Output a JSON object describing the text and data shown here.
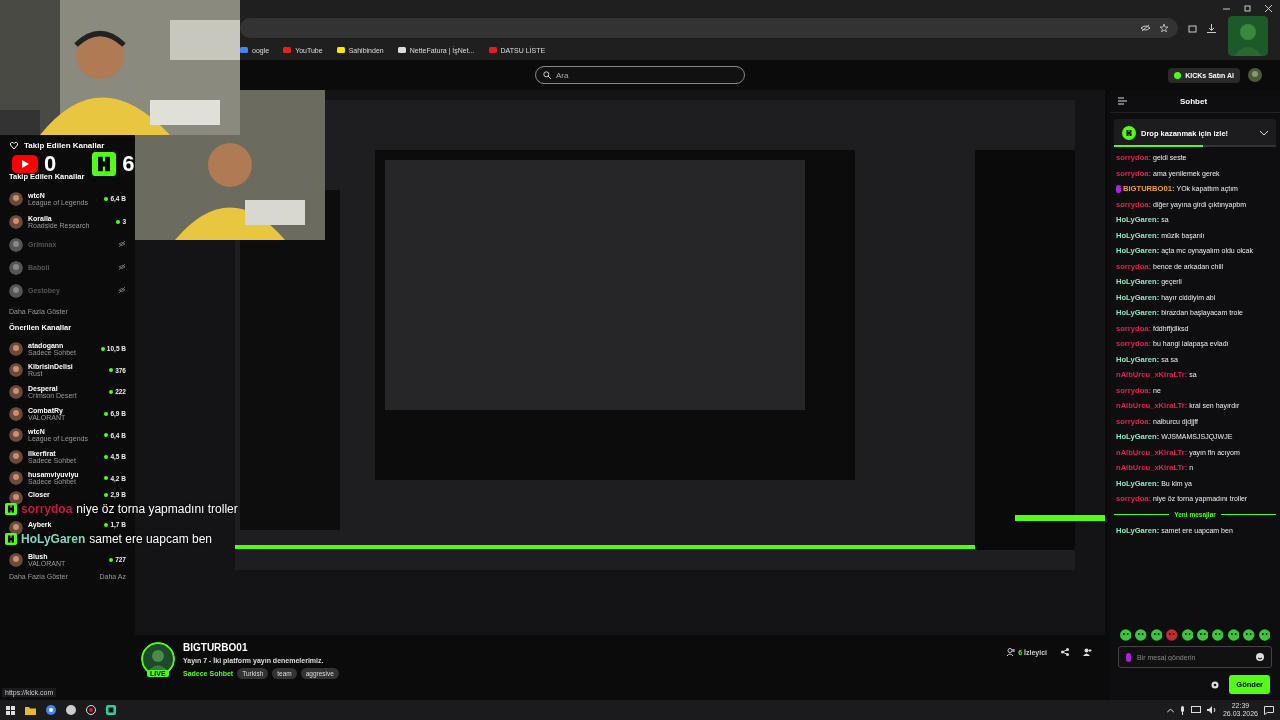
{
  "browser": {
    "bookmarks": [
      {
        "label": "oogle",
        "kind": "g"
      },
      {
        "label": "YouTube",
        "kind": "yt"
      },
      {
        "label": "Sahibinden",
        "kind": "s"
      },
      {
        "label": "NetteFatura | İşNet...",
        "kind": "doc"
      },
      {
        "label": "DATSU LİSTE",
        "kind": "pdf"
      }
    ]
  },
  "header": {
    "search": {
      "placeholder": "Ara"
    },
    "buy_button": "KICKs Satın Al"
  },
  "overlay": {
    "title": "Takip Edilen Kanallar",
    "counters": [
      {
        "kind": "youtube",
        "count": "0"
      },
      {
        "kind": "kick",
        "count": "6"
      }
    ],
    "chat": [
      {
        "user": "sorrydoa",
        "text": "niye öz torna yapmadını troller",
        "color": "#c8184a"
      },
      {
        "user": "HoLyGaren",
        "text": "samet ere uapcam ben",
        "color": "#7fd8c0"
      }
    ]
  },
  "sidebar": {
    "followed_title": "Takip Edilen Kanallar",
    "followed": [
      {
        "name": "wtcN",
        "category": "League of Legends",
        "viewers": "6,4 B",
        "live": true
      },
      {
        "name": "Koralla",
        "category": "Roadside Research",
        "viewers": "3",
        "live": true
      },
      {
        "name": "Grimnax",
        "live": false
      },
      {
        "name": "Baboli",
        "live": false
      },
      {
        "name": "Gestobey",
        "live": false
      }
    ],
    "followed_more": "Daha Fazla Göster",
    "recommended_title": "Önerilen Kanallar",
    "recommended": [
      {
        "name": "atadogann",
        "category": "Sadece Sohbet",
        "viewers": "10,5 B",
        "live": true
      },
      {
        "name": "KibrisinDelisi",
        "category": "Rust",
        "viewers": "376",
        "live": true
      },
      {
        "name": "Desperal",
        "category": "Crimson Desert",
        "viewers": "222",
        "live": true
      },
      {
        "name": "CombatRy",
        "category": "VALORANT",
        "viewers": "6,9 B",
        "live": true
      },
      {
        "name": "wtcN",
        "category": "League of Legends",
        "viewers": "6,4 B",
        "live": true
      },
      {
        "name": "ilkerfirat",
        "category": "Sadece Sohbet",
        "viewers": "4,5 B",
        "live": true
      },
      {
        "name": "husamviyuviyu",
        "category": "Sadece Sohbet",
        "viewers": "4,2 B",
        "live": true
      },
      {
        "name": "Closer",
        "viewers": "2,9 B",
        "live": true
      },
      {
        "name": "Ayberk",
        "viewers": "1,7 B",
        "live": true
      },
      {
        "name": "Blush",
        "category": "VALORANT",
        "viewers": "727",
        "live": true
      }
    ],
    "more": "Daha Fazla Göster",
    "less": "Daha Az"
  },
  "stream": {
    "live_badge": "LIVE",
    "name": "BIGTURBO01",
    "title": "Yayın 7 - İki platform yayın denemelerimiz.",
    "category": "Sadece Sohbet",
    "tags": [
      "Turkish",
      "team",
      "aggresive"
    ],
    "viewers": "6",
    "viewers_label": "İzleyici"
  },
  "chat": {
    "title": "Sohbet",
    "drop": {
      "text": "Drop kazanmak için izle!",
      "level": 0.55
    },
    "messages": [
      {
        "user": "sorrydoa:",
        "text": "geldi seste",
        "color": "#e0204f",
        "badge": false
      },
      {
        "user": "sorrydoa:",
        "text": "ama yenilemek gerek",
        "color": "#e0204f",
        "badge": false
      },
      {
        "user": "BIGTURBO01:",
        "text": "YOk kapattım açtım",
        "color": "#f0a020",
        "badge": true
      },
      {
        "user": "sorrydoa:",
        "text": "diğer yayına girdi çıktınyapbm",
        "color": "#e0204f",
        "badge": false
      },
      {
        "user": "HoLyGaren:",
        "text": "sa",
        "color": "#8ee3c0",
        "badge": false
      },
      {
        "user": "HoLyGaren:",
        "text": "müzik başarılı",
        "color": "#8ee3c0",
        "badge": false
      },
      {
        "user": "HoLyGaren:",
        "text": "açta mc oynayalım oldu olcak",
        "color": "#8ee3c0",
        "badge": false
      },
      {
        "user": "sorrydoa:",
        "text": "bence de arkadan chill",
        "color": "#e0204f",
        "badge": false
      },
      {
        "user": "HoLyGaren:",
        "text": "geçerli",
        "color": "#8ee3c0",
        "badge": false
      },
      {
        "user": "HoLyGaren:",
        "text": "hayır ciddiyim abi",
        "color": "#8ee3c0",
        "badge": false
      },
      {
        "user": "HoLyGaren:",
        "text": "birazdan başlayacam trole",
        "color": "#8ee3c0",
        "badge": false
      },
      {
        "user": "sorrydoa:",
        "text": "fddhffjdlksd",
        "color": "#e0204f",
        "badge": false
      },
      {
        "user": "sorrydoa:",
        "text": "bu hangi lalapaşa evladı",
        "color": "#e0204f",
        "badge": false
      },
      {
        "user": "HoLyGaren:",
        "text": "sa sa",
        "color": "#8ee3c0",
        "badge": false
      },
      {
        "user": "nAlbUrcu_xKiraLTr:",
        "text": "sa",
        "color": "#e0204f",
        "badge": false
      },
      {
        "user": "sorrydoa:",
        "text": "ne",
        "color": "#e0204f",
        "badge": false
      },
      {
        "user": "nAlbUrcu_xKiraLTr:",
        "text": "kral sen hayırdır",
        "color": "#e0204f",
        "badge": false
      },
      {
        "user": "sorrydoa:",
        "text": "nalburcu djdjjff",
        "color": "#e0204f",
        "badge": false
      },
      {
        "user": "HoLyGaren:",
        "text": "WJSMAMSJSJQJWJE",
        "color": "#8ee3c0",
        "badge": false
      },
      {
        "user": "nAlbUrcu_xKiraLTr:",
        "text": "yayın fln acıyom",
        "color": "#e0204f",
        "badge": false
      },
      {
        "user": "nAlbUrcu_xKiraLTr:",
        "text": "n",
        "color": "#e0204f",
        "badge": false
      },
      {
        "user": "HoLyGaren:",
        "text": "Bu kim ya",
        "color": "#8ee3c0",
        "badge": false
      },
      {
        "user": "sorrydoa:",
        "text": "niye öz torna yapmadını troller",
        "color": "#e0204f",
        "badge": false
      }
    ],
    "new_divider": "Yeni mesajlar",
    "new_messages": [
      {
        "user": "HoLyGaren:",
        "text": "samet ere uapcam ben",
        "color": "#8ee3c0",
        "badge": false
      }
    ],
    "input": {
      "placeholder": "Bir mesaj gönderin"
    },
    "send_button": "Gönder"
  },
  "status_url": "https://kick.com",
  "taskbar": {
    "time": "22:39",
    "date": "26.03.2026"
  }
}
